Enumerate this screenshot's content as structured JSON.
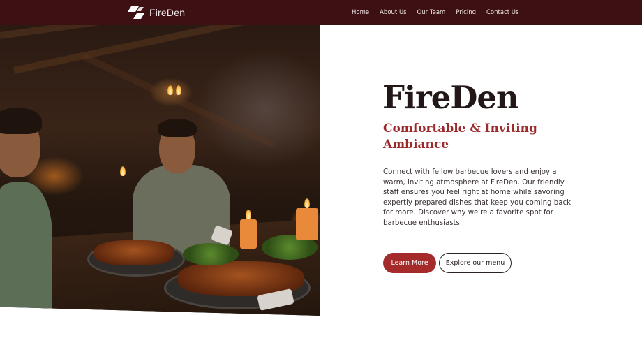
{
  "header": {
    "brand_name": "FireDen",
    "nav": [
      "Home",
      "About Us",
      "Our Team",
      "Pricing",
      "Contact Us"
    ]
  },
  "hero": {
    "image_icon": "barbecue-dinner-photo",
    "title": "FireDen",
    "subtitle": "Comfortable & Inviting Ambiance",
    "description": "Connect with fellow barbecue lovers and enjoy a warm, inviting atmosphere at FireDen. Our friendly staff ensures you feel right at home while savoring expertly prepared dishes that keep you coming back for more. Discover why we're a favorite spot for barbecue enthusiasts.",
    "primary_button": "Learn More",
    "secondary_button": "Explore our menu"
  },
  "colors": {
    "header_bg": "#3d1113",
    "accent": "#a52a2a",
    "title_text": "#231717"
  }
}
